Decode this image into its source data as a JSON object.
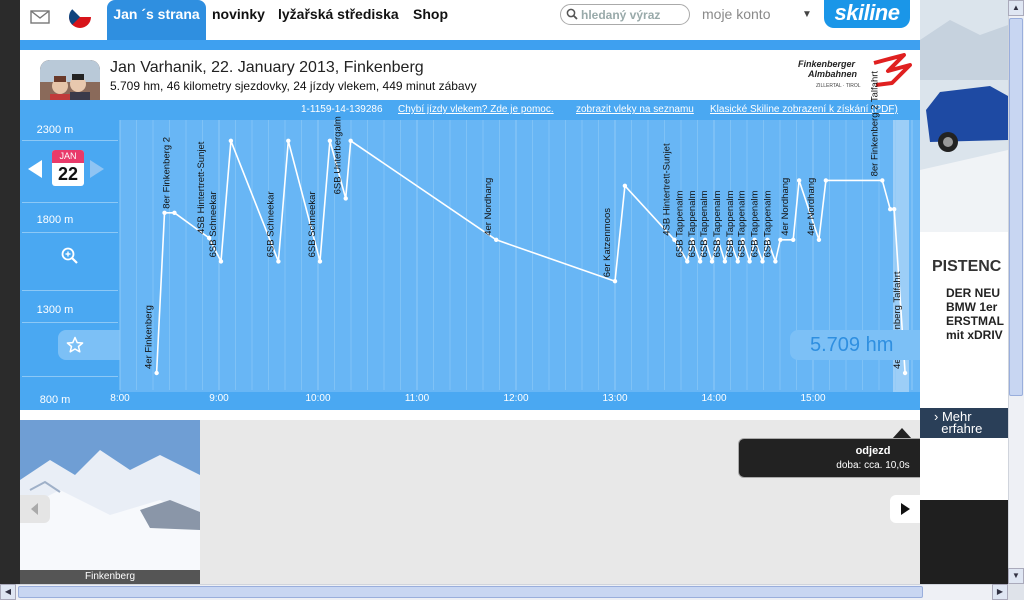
{
  "nav": {
    "user_tab": "Jan ´s strana",
    "links": [
      "novinky",
      "lyžařská střediska",
      "Shop"
    ],
    "search_placeholder": "hledaný výraz",
    "account_label": "moje konto",
    "account_arrow": "▼",
    "logo_text": "skiline"
  },
  "header": {
    "title": "Jan Varhanik, 22. January 2013, Finkenberg",
    "summary": "5.709 hm, 46 kilometry sjezdovky, 24 jízdy vlekem, 449 minut zábavy",
    "resort_logo_lines": [
      "Finkenberger",
      "Almbahnen",
      "ZILLERTAL · TIROL"
    ]
  },
  "infobar": {
    "id": "1-1159-14-139286",
    "links": [
      "Chybí jízdy vlekem? Zde je pomoc.",
      "zobrazit vleky na seznamu",
      "Klasické Skiline zobrazení k získání (PDF)"
    ]
  },
  "calendar": {
    "month": "JAN",
    "day": "22"
  },
  "total_badge": "5.709 hm",
  "tooltip": {
    "title": "odjezd",
    "detail": "doba: cca. 10,0s"
  },
  "photo_caption": "Finkenberg",
  "ad": {
    "title": "PISTENC",
    "text": "DER NEU\nBMW 1er\nERSTMAL\nmit xDRIV",
    "more": "› Mehr\n  erfahre"
  },
  "colors": {
    "brand": "#1a96e8",
    "chart_bg": "#4aa8f2",
    "chart_panel": "#6fb8f4",
    "accent": "#e93a6a"
  },
  "chart_data": {
    "type": "line",
    "xlabel": "",
    "ylabel": "",
    "x_ticks": [
      "8:00",
      "9:00",
      "10:00",
      "11:00",
      "12:00",
      "13:00",
      "14:00",
      "15:00"
    ],
    "y_ticks": [
      "2300 m",
      "1800 m",
      "1300 m",
      "800 m"
    ],
    "ylim": [
      800,
      2300
    ],
    "xlim_hours": [
      8.0,
      16.0
    ],
    "grid": true,
    "points": [
      {
        "t": 8.37,
        "alt": 950
      },
      {
        "t": 8.45,
        "alt": 1840
      },
      {
        "t": 8.55,
        "alt": 1840
      },
      {
        "t": 8.9,
        "alt": 1700
      },
      {
        "t": 9.02,
        "alt": 1570
      },
      {
        "t": 9.12,
        "alt": 2240
      },
      {
        "t": 9.6,
        "alt": 1570
      },
      {
        "t": 9.7,
        "alt": 2240
      },
      {
        "t": 10.02,
        "alt": 1570
      },
      {
        "t": 10.12,
        "alt": 2240
      },
      {
        "t": 10.28,
        "alt": 1920
      },
      {
        "t": 10.33,
        "alt": 2240
      },
      {
        "t": 11.8,
        "alt": 1690
      },
      {
        "t": 13.0,
        "alt": 1460
      },
      {
        "t": 13.1,
        "alt": 1990
      },
      {
        "t": 13.6,
        "alt": 1690
      },
      {
        "t": 13.73,
        "alt": 1570
      },
      {
        "t": 13.78,
        "alt": 1690
      },
      {
        "t": 13.86,
        "alt": 1570
      },
      {
        "t": 13.91,
        "alt": 1690
      },
      {
        "t": 13.98,
        "alt": 1570
      },
      {
        "t": 14.04,
        "alt": 1690
      },
      {
        "t": 14.11,
        "alt": 1570
      },
      {
        "t": 14.16,
        "alt": 1690
      },
      {
        "t": 14.24,
        "alt": 1570
      },
      {
        "t": 14.29,
        "alt": 1690
      },
      {
        "t": 14.36,
        "alt": 1570
      },
      {
        "t": 14.41,
        "alt": 1690
      },
      {
        "t": 14.49,
        "alt": 1570
      },
      {
        "t": 14.54,
        "alt": 1690
      },
      {
        "t": 14.62,
        "alt": 1570
      },
      {
        "t": 14.67,
        "alt": 1690
      },
      {
        "t": 14.8,
        "alt": 1690
      },
      {
        "t": 14.86,
        "alt": 2020
      },
      {
        "t": 15.06,
        "alt": 1690
      },
      {
        "t": 15.13,
        "alt": 2020
      },
      {
        "t": 15.7,
        "alt": 2020
      },
      {
        "t": 15.78,
        "alt": 1860
      },
      {
        "t": 15.82,
        "alt": 1860
      },
      {
        "t": 15.93,
        "alt": 950
      }
    ],
    "lift_labels": [
      {
        "t": 8.37,
        "label": "4er Finkenberg"
      },
      {
        "t": 8.55,
        "label": "8er Finkenberg 2"
      },
      {
        "t": 8.9,
        "label": "4SB Hintertrett-Sunjet"
      },
      {
        "t": 9.02,
        "label": "6SB Schneekar"
      },
      {
        "t": 9.6,
        "label": "6SB Schneekar"
      },
      {
        "t": 10.02,
        "label": "6SB Schneekar"
      },
      {
        "t": 10.28,
        "label": "6SB Unterbergalm"
      },
      {
        "t": 11.8,
        "label": "4er Nordhang"
      },
      {
        "t": 13.0,
        "label": "6er Katzenmoos"
      },
      {
        "t": 13.6,
        "label": "4SB Hintertrett-Sunjet"
      },
      {
        "t": 13.73,
        "label": "6SB Tappenalm"
      },
      {
        "t": 13.86,
        "label": "6SB Tappenalm"
      },
      {
        "t": 13.98,
        "label": "6SB Tappenalm"
      },
      {
        "t": 14.11,
        "label": "6SB Tappenalm"
      },
      {
        "t": 14.24,
        "label": "6SB Tappenalm"
      },
      {
        "t": 14.36,
        "label": "6SB Tappenalm"
      },
      {
        "t": 14.49,
        "label": "6SB Tappenalm"
      },
      {
        "t": 14.62,
        "label": "6SB Tappenalm"
      },
      {
        "t": 14.8,
        "label": "4er Nordhang"
      },
      {
        "t": 15.06,
        "label": "4er Nordhang"
      },
      {
        "t": 15.7,
        "label": "8er Finkenberg 2 Talfahrt"
      },
      {
        "t": 15.93,
        "label": "4er Finkenberg Talfahrt"
      }
    ]
  }
}
